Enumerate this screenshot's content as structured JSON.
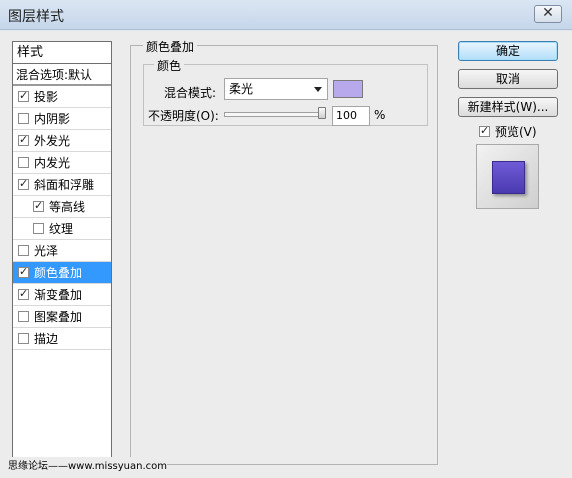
{
  "window": {
    "title": "图层样式",
    "close_label": "✕"
  },
  "styles_panel": {
    "header": "样式",
    "blend_options": "混合选项:默认",
    "items": [
      {
        "label": "投影",
        "checked": true
      },
      {
        "label": "内阴影",
        "checked": false
      },
      {
        "label": "外发光",
        "checked": true
      },
      {
        "label": "内发光",
        "checked": false
      },
      {
        "label": "斜面和浮雕",
        "checked": true
      },
      {
        "label": "等高线",
        "checked": true
      },
      {
        "label": "纹理",
        "checked": false
      },
      {
        "label": "光泽",
        "checked": false
      },
      {
        "label": "颜色叠加",
        "checked": true,
        "selected": true
      },
      {
        "label": "渐变叠加",
        "checked": true
      },
      {
        "label": "图案叠加",
        "checked": false
      },
      {
        "label": "描边",
        "checked": false
      }
    ]
  },
  "color_overlay": {
    "group_title": "颜色叠加",
    "subgroup_title": "颜色",
    "blend_mode_label": "混合模式:",
    "blend_mode_value": "柔光",
    "swatch_color": "#b8a9ec",
    "opacity_label": "不透明度(O):",
    "opacity_value": "100",
    "opacity_unit": "%",
    "opacity_level": 1.0
  },
  "buttons": {
    "ok": "确定",
    "cancel": "取消",
    "new_style": "新建样式(W)..."
  },
  "preview": {
    "label": "预览(V)",
    "checked": true,
    "swatch_color": "#5c49c7"
  },
  "watermark": "思缘论坛——www.missyuan.com"
}
